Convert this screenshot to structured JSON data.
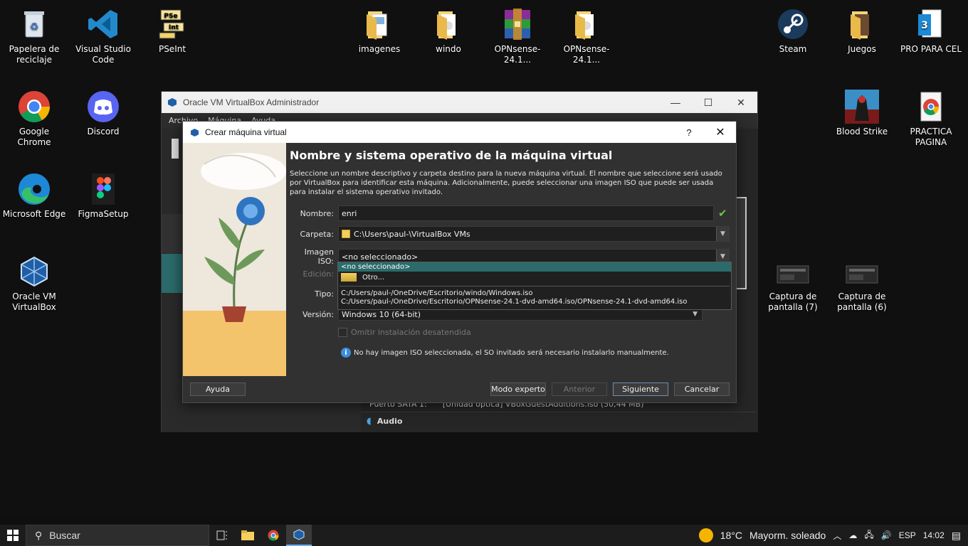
{
  "desktop": {
    "icons": [
      {
        "label": "Papelera de reciclaje",
        "icon": "recycle-bin-icon"
      },
      {
        "label": "Visual Studio Code",
        "icon": "vscode-icon"
      },
      {
        "label": "PSeInt",
        "icon": "pseint-icon"
      },
      {
        "label": "imagenes",
        "icon": "folder-icon"
      },
      {
        "label": "windo",
        "icon": "folder-icon"
      },
      {
        "label": "OPNsense-24.1...",
        "icon": "winrar-icon"
      },
      {
        "label": "OPNsense-24.1...",
        "icon": "folder-icon"
      },
      {
        "label": "Steam",
        "icon": "steam-icon"
      },
      {
        "label": "Juegos",
        "icon": "folder-icon"
      },
      {
        "label": "PRO PARA CEL",
        "icon": "document-icon"
      },
      {
        "label": "Google Chrome",
        "icon": "chrome-icon"
      },
      {
        "label": "Discord",
        "icon": "discord-icon"
      },
      {
        "label": "Blood Strike",
        "icon": "game-icon"
      },
      {
        "label": "PRACTICA PAGINA",
        "icon": "chrome-doc-icon"
      },
      {
        "label": "Microsoft Edge",
        "icon": "edge-icon"
      },
      {
        "label": "FigmaSetup",
        "icon": "figma-icon"
      },
      {
        "label": "Oracle VM VirtualBox",
        "icon": "virtualbox-icon"
      },
      {
        "label": "Captura de pantalla (7)",
        "icon": "screenshot-icon"
      },
      {
        "label": "Captura de pantalla (6)",
        "icon": "screenshot-icon"
      }
    ]
  },
  "vbox_manager": {
    "title": "Oracle VM VirtualBox Administrador",
    "menu": [
      "Archivo",
      "Máquina",
      "Ayuda"
    ],
    "storage_line": {
      "label": "Puerto SATA 1:",
      "value": "[Unidad óptica] VBoxGuestAdditions.iso (50,44 MB)"
    },
    "audio_label": "Audio"
  },
  "dialog": {
    "title": "Crear máquina virtual",
    "help_glyph": "?",
    "close_glyph": "✕",
    "heading": "Nombre y sistema operativo de la máquina virtual",
    "description": "Seleccione un nombre descriptivo y carpeta destino para la nueva máquina virtual. El nombre que seleccione será usado por VirtualBox para identificar esta máquina. Adicionalmente, puede seleccionar una imagen ISO que puede ser usada para instalar el sistema operativo invitado.",
    "name_label": "Nombre:",
    "name_value": "enri",
    "folder_label": "Carpeta:",
    "folder_value": "C:\\Users\\paul-\\VirtualBox VMs",
    "iso_label": "Imagen ISO:",
    "iso_value": "<no seleccionado>",
    "edition_label": "Edición:",
    "type_label": "Tipo:",
    "version_label": "Versión:",
    "version_value": "Windows 10 (64-bit)",
    "unattended_label": "Omitir instalación desatendida",
    "info_text": "No hay imagen ISO seleccionada, el SO invitado será necesario instalarlo manualmente.",
    "dropdown": {
      "selected": "<no seleccionado>",
      "other": "Otro...",
      "recent": [
        "C:/Users/paul-/OneDrive/Escritorio/windo/Windows.iso",
        "C:/Users/paul-/OneDrive/Escritorio/OPNsense-24.1-dvd-amd64.iso/OPNsense-24.1-dvd-amd64.iso"
      ]
    },
    "buttons": {
      "help": "Ayuda",
      "expert": "Modo experto",
      "back": "Anterior",
      "next": "Siguiente",
      "cancel": "Cancelar"
    }
  },
  "taskbar": {
    "search_placeholder": "Buscar",
    "weather_temp": "18°C",
    "weather_desc": "Mayorm. soleado",
    "language": "ESP",
    "time": "14:02"
  }
}
